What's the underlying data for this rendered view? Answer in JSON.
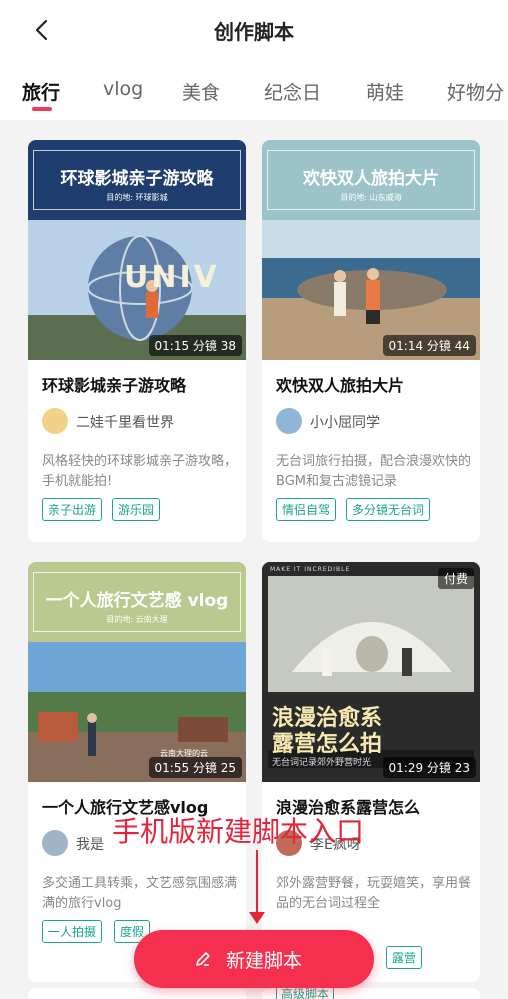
{
  "header": {
    "title": "创作脚本"
  },
  "tabs": [
    "旅行",
    "vlog",
    "美食",
    "纪念日",
    "萌娃",
    "好物分"
  ],
  "cards": [
    {
      "banner_title": "环球影城亲子游攻略",
      "banner_subtitle": "目的地: 环球影城",
      "scene_text": "UNIV",
      "duration": "01:15 分镜 38",
      "title": "环球影城亲子游攻略",
      "author": "二娃千里看世界",
      "desc": "风格轻快的环球影城亲子游攻略，手机就能拍!",
      "tags": [
        "亲子出游",
        "游乐园"
      ],
      "colors": {
        "banner": "#1f3d6e"
      }
    },
    {
      "banner_title": "欢快双人旅拍大片",
      "banner_subtitle": "目的地: 山东威海",
      "duration": "01:14 分镜 44",
      "title": "欢快双人旅拍大片",
      "author": "小小屈同学",
      "desc": "无台词旅行拍摄，配合浪漫欢快的BGM和复古滤镜记录",
      "tags": [
        "情侣自驾",
        "多分镜无台词"
      ],
      "colors": {
        "banner": "#9cc3c9"
      }
    },
    {
      "banner_title": "一个人旅行文艺感 vlog",
      "banner_subtitle": "目的地: 云南大理",
      "scene_text": "云南大理的云",
      "duration": "01:55 分镜 25",
      "title": "一个人旅行文艺感vlog",
      "author": "我是",
      "desc": "多交通工具转乘，文艺感氛围感满满的旅行vlog",
      "tags": [
        "一人拍摄",
        "度假"
      ],
      "colors": {
        "banner": "#b9c98f"
      }
    },
    {
      "paid": "付费",
      "poster_tag": "MAKE IT INCREDIBLE",
      "poster_title_1": "浪漫治愈系",
      "poster_title_2": "露营怎么拍",
      "poster_caption": "无台词记录郊外野营时光",
      "duration": "01:29 分镜 23",
      "title": "浪漫治愈系露营怎么",
      "author": "李E疯呀",
      "desc": "郊外露营野餐，玩耍嬉笑，享用餐品的无台词过程全",
      "tags": [
        "露营"
      ],
      "colors": {
        "banner": "#2b2b2b"
      }
    }
  ],
  "annotation": "手机版新建脚本入口",
  "fab": {
    "label": "新建脚本"
  },
  "peek_tag": "高级脚本",
  "colors": {
    "accent": "#f5304f",
    "tag": "#1aa58a",
    "annotation": "#e4243b"
  }
}
